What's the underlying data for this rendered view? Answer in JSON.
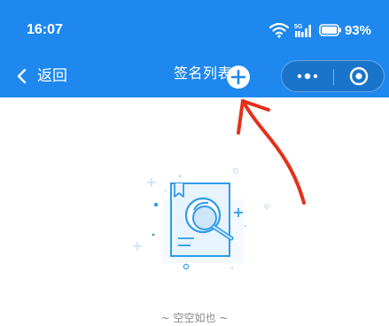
{
  "status_bar": {
    "time": "16:07",
    "signal_badge": "5G",
    "battery": "93%"
  },
  "nav_bar": {
    "back_label": "返回",
    "title": "签名列表",
    "add_button_icon": "plus-icon",
    "menu_icon": "more-dots-icon",
    "close_icon": "target-circle-icon"
  },
  "empty_state": {
    "message": "~ 空空如也 ~",
    "illustration_icon": "document-search-icon"
  },
  "colors": {
    "nav_blue": "#1e88ee",
    "illustration_blue": "#2f9be8",
    "annotation_red": "#e5301c"
  }
}
